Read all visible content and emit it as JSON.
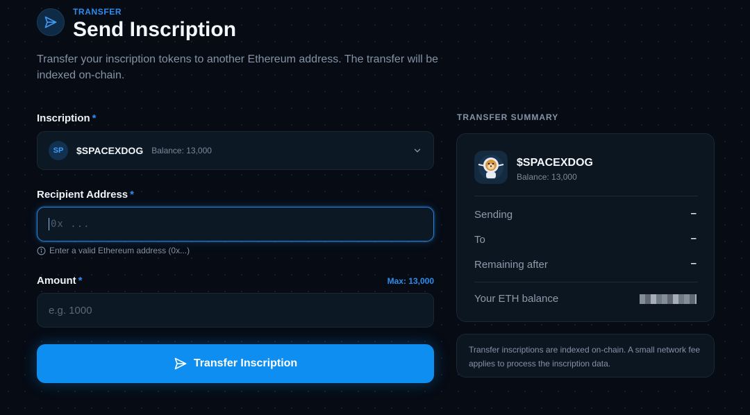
{
  "header": {
    "eyebrow": "TRANSFER",
    "title": "Send Inscription",
    "subtitle": "Transfer your inscription tokens to another Ethereum address. The transfer will be indexed on-chain."
  },
  "form": {
    "inscription": {
      "label": "Inscription",
      "required_mark": "*",
      "selected_badge": "SP",
      "selected_name": "$SPACEXDOG",
      "selected_balance": "Balance: 13,000"
    },
    "recipient": {
      "label": "Recipient Address",
      "required_mark": "*",
      "placeholder": "0x ...",
      "hint": "Enter a valid Ethereum address (0x...)"
    },
    "amount": {
      "label": "Amount",
      "required_mark": "*",
      "max_label": "Max: 13,000",
      "placeholder": "e.g. 1000"
    },
    "submit_label": "Transfer Inscription"
  },
  "summary": {
    "heading": "TRANSFER SUMMARY",
    "token_name": "$SPACEXDOG",
    "token_balance": "Balance: 13,000",
    "rows": [
      {
        "label": "Sending",
        "value": "–"
      },
      {
        "label": "To",
        "value": "–"
      },
      {
        "label": "Remaining after",
        "value": "–"
      }
    ],
    "eth_balance_label": "Your ETH balance",
    "note": "Transfer inscriptions are indexed on-chain. A small network fee applies to process the inscription data."
  },
  "colors": {
    "accent": "#2d8ef0",
    "button": "#0d8ef0",
    "background": "#060b14"
  },
  "icons": {
    "header": "send-icon",
    "select": "chevron-down-icon",
    "hint": "info-icon",
    "button": "send-icon",
    "token": "dog-astronaut-icon"
  }
}
